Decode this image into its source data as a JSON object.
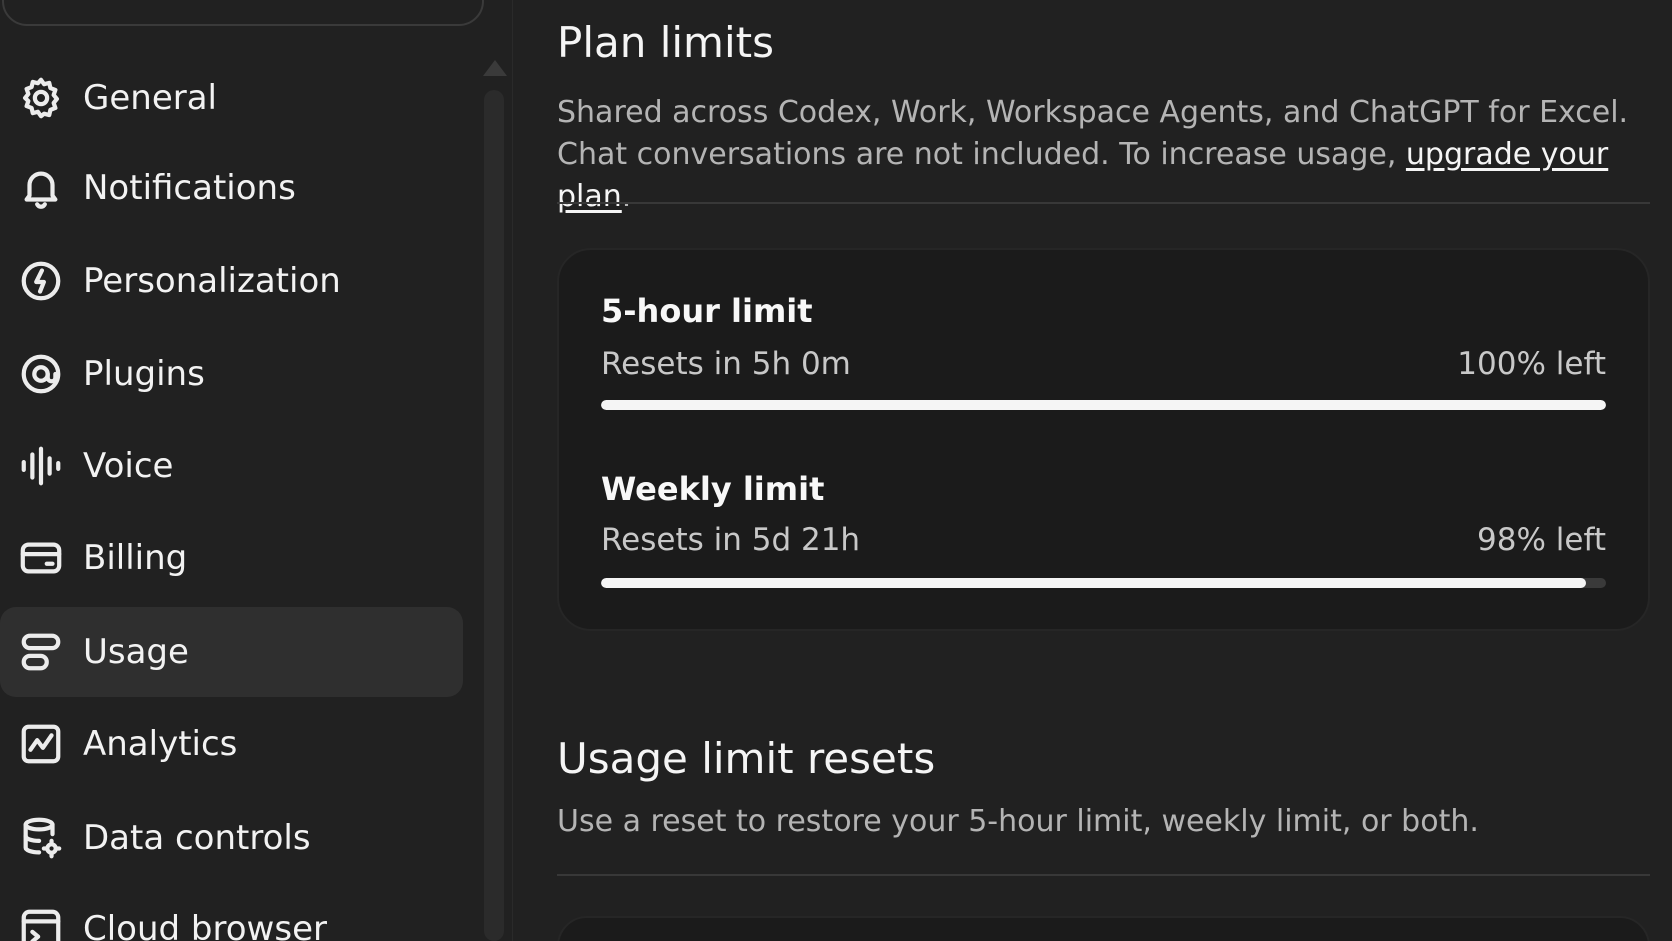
{
  "sidebar": {
    "items": [
      {
        "label": "General",
        "icon": "gear-icon"
      },
      {
        "label": "Notifications",
        "icon": "bell-icon"
      },
      {
        "label": "Personalization",
        "icon": "personalization-icon"
      },
      {
        "label": "Plugins",
        "icon": "plugin-icon"
      },
      {
        "label": "Voice",
        "icon": "voice-waveform-icon"
      },
      {
        "label": "Billing",
        "icon": "credit-card-icon"
      },
      {
        "label": "Usage",
        "icon": "usage-icon",
        "active": true
      },
      {
        "label": "Analytics",
        "icon": "analytics-chart-icon"
      },
      {
        "label": "Data controls",
        "icon": "database-settings-icon"
      },
      {
        "label": "Cloud browser",
        "icon": "browser-icon"
      }
    ]
  },
  "plan_limits": {
    "title": "Plan limits",
    "description_prefix": "Shared across Codex, Work, Workspace Agents, and ChatGPT for Excel. Chat conversations are not included. To increase usage, ",
    "upgrade_link": "upgrade your plan",
    "description_suffix": ".",
    "limits": [
      {
        "title": "5-hour limit",
        "reset": "Resets in 5h 0m",
        "left": "100% left",
        "fraction_left": 1.0
      },
      {
        "title": "Weekly limit",
        "reset": "Resets in 5d 21h",
        "left": "98% left",
        "fraction_left": 0.98
      }
    ]
  },
  "resets": {
    "title": "Usage limit resets",
    "description": "Use a reset to restore your 5-hour limit, weekly limit, or both."
  },
  "colors": {
    "background": "#212121",
    "active_item": "#2f2f2f",
    "card": "#1b1b1b",
    "bar_fill": "#f5f5f5",
    "bar_track": "#3a3a3a"
  }
}
